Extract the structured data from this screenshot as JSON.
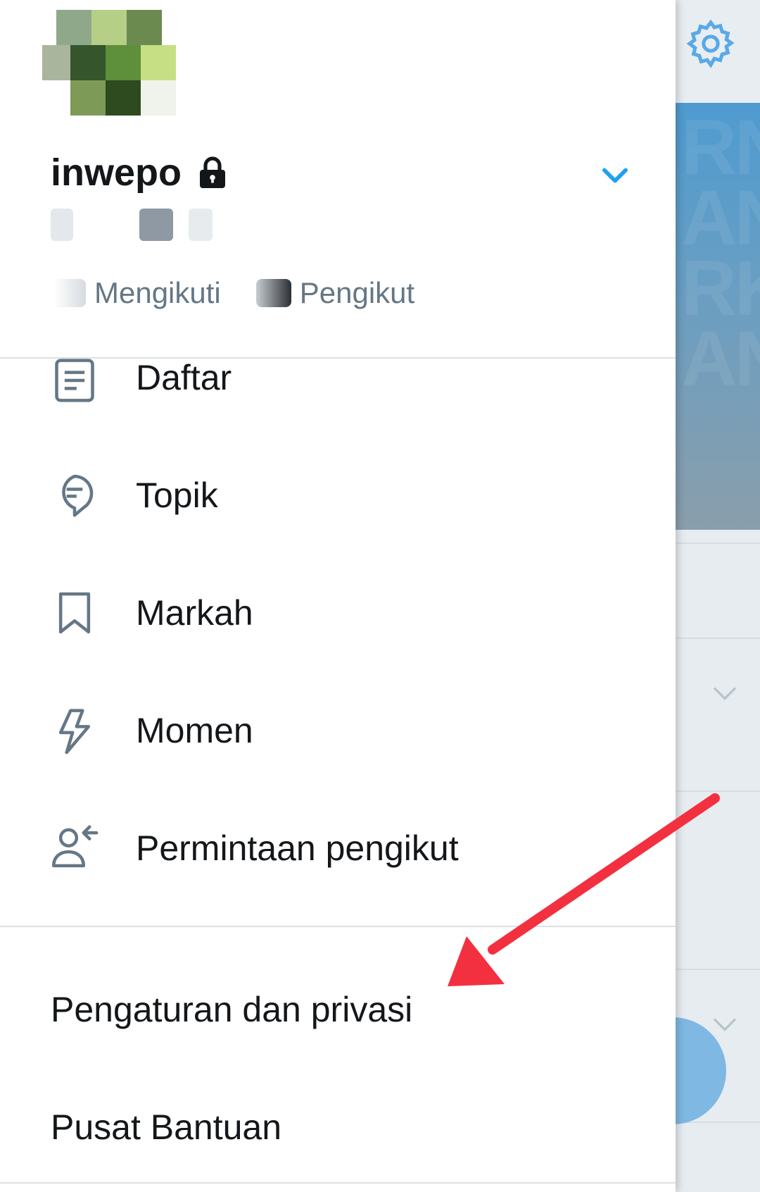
{
  "profile": {
    "name": "inwepo",
    "following_label": "Mengikuti",
    "followers_label": "Pengikut"
  },
  "menu": {
    "items": [
      {
        "label": "Daftar",
        "icon": "list-icon"
      },
      {
        "label": "Topik",
        "icon": "topic-bubble-icon"
      },
      {
        "label": "Markah",
        "icon": "bookmark-icon"
      },
      {
        "label": "Momen",
        "icon": "lightning-icon"
      },
      {
        "label": "Permintaan pengikut",
        "icon": "follower-request-icon"
      }
    ],
    "settings_label": "Pengaturan dan privasi",
    "help_label": "Pusat Bantuan"
  },
  "background": {
    "top_icon": "gear-icon",
    "fab_icon": "compose-icon"
  },
  "colors": {
    "accent": "#1da1f2",
    "text_primary": "#14171a",
    "text_secondary": "#657786",
    "icon_gray": "#657786",
    "annotation_arrow": "#f3303f"
  }
}
